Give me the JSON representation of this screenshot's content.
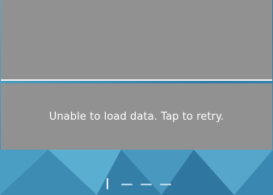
{
  "error": {
    "message": "Unable to load data. Tap to retry."
  },
  "pager": {
    "pages": 4,
    "active_index": 0
  },
  "colors": {
    "panel": "#919191",
    "background": "#3f8fb5",
    "text": "#ffffff"
  }
}
